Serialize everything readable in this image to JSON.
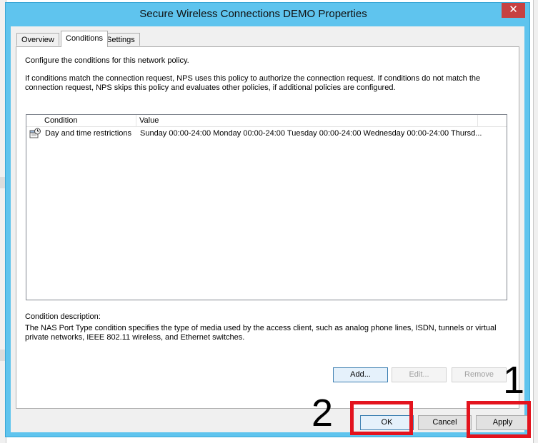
{
  "dialog": {
    "title": "Secure Wireless Connections DEMO Properties",
    "close_glyph": "✕"
  },
  "tabs": [
    {
      "label": "Overview",
      "active": false
    },
    {
      "label": "Conditions",
      "active": true
    },
    {
      "label": "Settings",
      "active": false
    }
  ],
  "conditions_page": {
    "intro": "Configure the conditions for this network policy.",
    "explanation": "If conditions match the connection request, NPS uses this policy to authorize the connection request. If conditions do not match the connection request, NPS skips this policy and evaluates other policies, if additional policies are configured.",
    "list": {
      "columns": [
        "Condition",
        "Value"
      ],
      "rows": [
        {
          "icon": "calendar-clock-icon",
          "condition": "Day and time restrictions",
          "value": "Sunday 00:00-24:00 Monday 00:00-24:00 Tuesday 00:00-24:00 Wednesday 00:00-24:00 Thursd..."
        }
      ]
    },
    "description_label": "Condition description:",
    "description": "The NAS Port Type condition specifies the type of media used by the access client, such as analog phone lines, ISDN, tunnels or virtual private networks, IEEE 802.11 wireless, and Ethernet switches.",
    "buttons": {
      "add": "Add...",
      "edit": "Edit...",
      "remove": "Remove"
    }
  },
  "footer": {
    "ok": "OK",
    "cancel": "Cancel",
    "apply": "Apply"
  },
  "annotations": {
    "apply_number": "1",
    "ok_number": "2",
    "highlight_color": "#e3131d"
  }
}
